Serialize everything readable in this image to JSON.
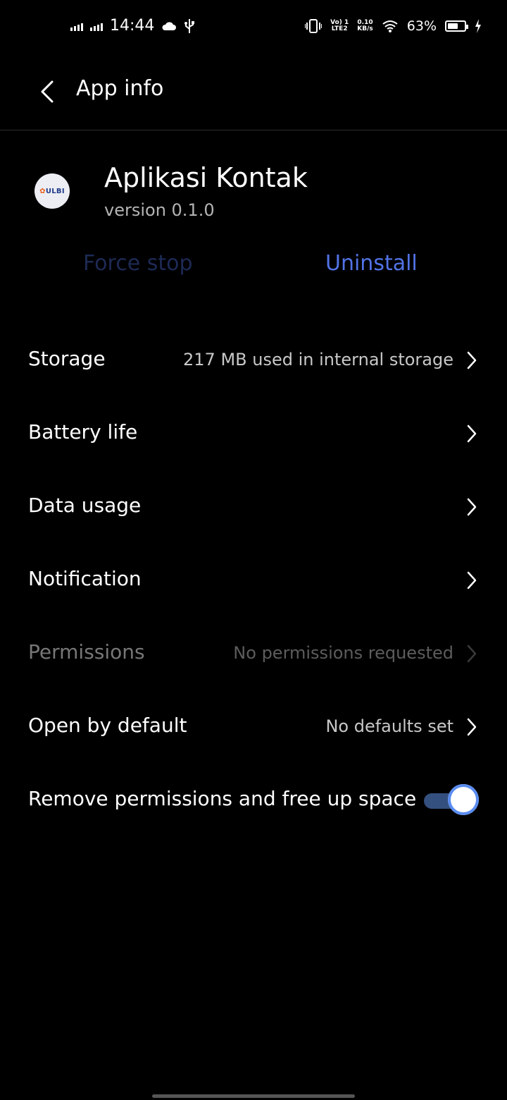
{
  "status_bar": {
    "time": "14:44",
    "network_top": "Vo) 1",
    "network_bottom": "LTE2",
    "speed_value": "0.10",
    "speed_unit": "KB/s",
    "battery_percent": "63%",
    "battery_level": 0.63
  },
  "header": {
    "title": "App info"
  },
  "app": {
    "name": "Aplikasi Kontak",
    "version": "version 0.1.0",
    "icon_text": "ULBI"
  },
  "actions": {
    "force_stop": "Force stop",
    "uninstall": "Uninstall"
  },
  "settings": {
    "storage": {
      "label": "Storage",
      "value": "217 MB used in internal storage"
    },
    "battery": {
      "label": "Battery life"
    },
    "data_usage": {
      "label": "Data usage"
    },
    "notification": {
      "label": "Notification"
    },
    "permissions": {
      "label": "Permissions",
      "value": "No permissions requested"
    },
    "open_by_default": {
      "label": "Open by default",
      "value": "No defaults set"
    },
    "remove_permissions": {
      "label": "Remove permissions and free up space",
      "enabled": true
    }
  },
  "colors": {
    "accent": "#5273e6",
    "disabled_accent": "#1d2a55",
    "toggle_track": "#34507f"
  }
}
